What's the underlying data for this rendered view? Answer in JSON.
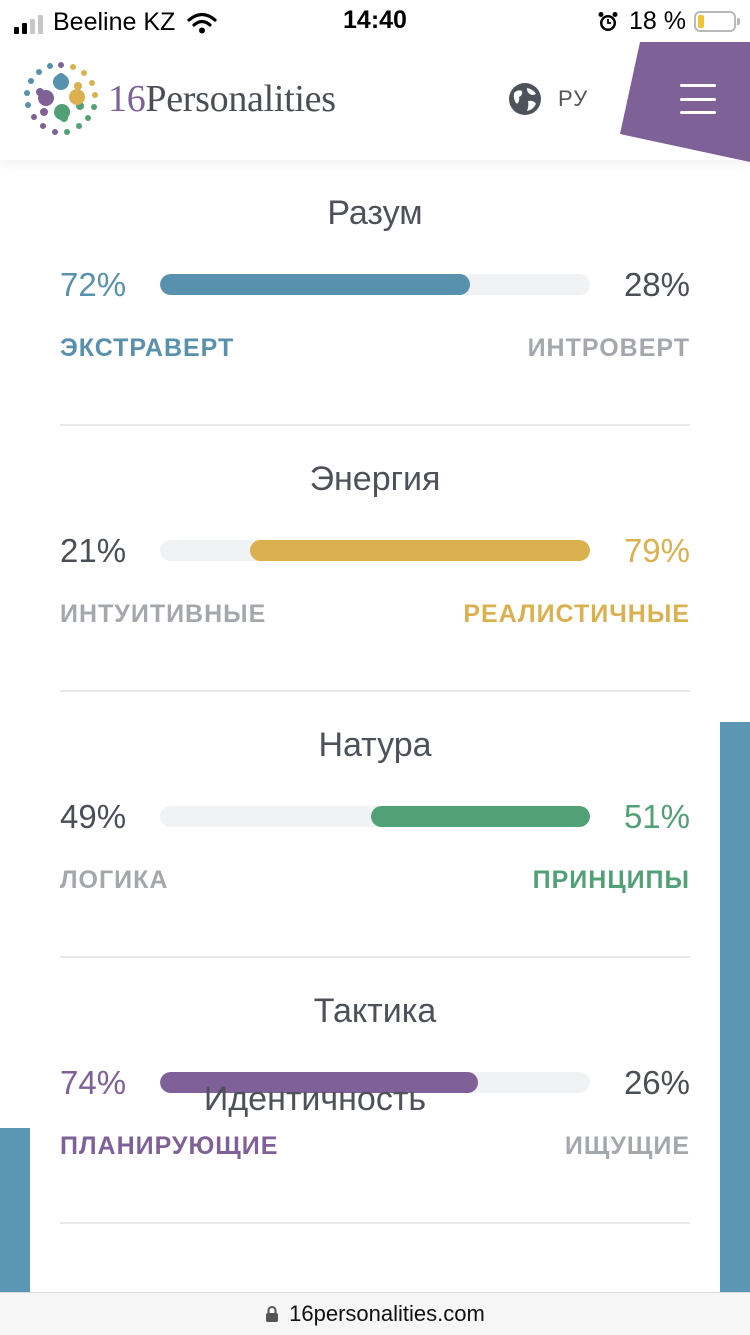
{
  "status_bar": {
    "carrier": "Beeline KZ",
    "time": "14:40",
    "battery_percent": "18 %",
    "battery_level": 0.18
  },
  "header": {
    "logo_number": "16",
    "logo_word": "Personalities",
    "language": "РУ"
  },
  "traits": [
    {
      "title": "Разум",
      "left_percent": "72%",
      "right_percent": "28%",
      "left_label": "ЭКСТРАВЕРТ",
      "right_label": "ИНТРОВЕРТ",
      "dominant": "left",
      "fill_fraction": 0.72,
      "color": "#5791ad"
    },
    {
      "title": "Энергия",
      "left_percent": "21%",
      "right_percent": "79%",
      "left_label": "ИНТУИТИВНЫЕ",
      "right_label": "РЕАЛИСТИЧНЫЕ",
      "dominant": "right",
      "fill_fraction": 0.79,
      "color": "#dbb14f"
    },
    {
      "title": "Натура",
      "left_percent": "49%",
      "right_percent": "51%",
      "left_label": "ЛОГИКА",
      "right_label": "ПРИНЦИПЫ",
      "dominant": "right",
      "fill_fraction": 0.51,
      "color": "#52a075"
    },
    {
      "title": "Тактика",
      "left_percent": "74%",
      "right_percent": "26%",
      "left_label": "ПЛАНИРУЮЩИЕ",
      "right_label": "ИЩУЩИЕ",
      "dominant": "left",
      "fill_fraction": 0.74,
      "color": "#7f6098"
    }
  ],
  "next_section_title": "Идентичность",
  "url_bar": {
    "url": "16personalities.com"
  },
  "colors": {
    "muted": "#a4a8ad",
    "dark_text": "#4a4f56",
    "accent_purple": "#7e6197",
    "accent_blue": "#5b97b5"
  }
}
